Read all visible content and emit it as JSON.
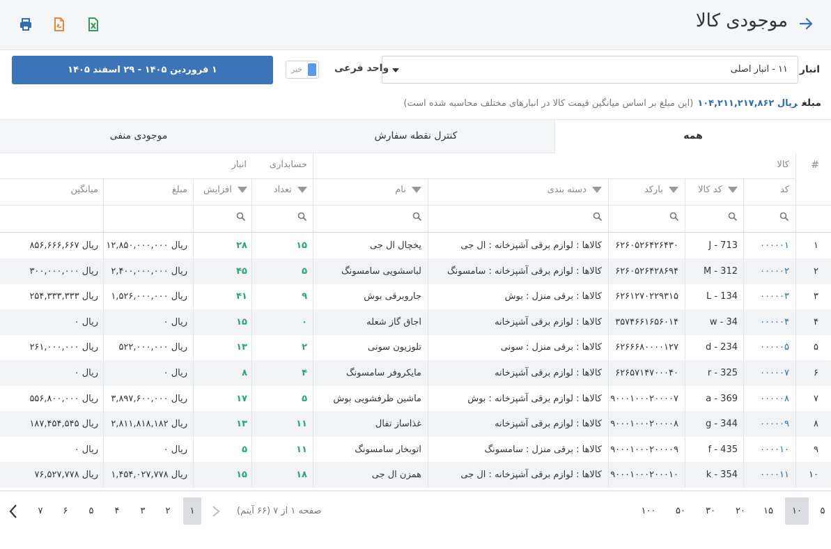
{
  "header": {
    "title": "موجودی کالا",
    "back_icon": "arrow-right-icon",
    "tools": [
      {
        "name": "print-icon",
        "color": "#2f6db3"
      },
      {
        "name": "pdf-export-icon",
        "color": "#e58a2f"
      },
      {
        "name": "excel-export-icon",
        "color": "#2e9c5b"
      }
    ]
  },
  "filters": {
    "warehouse_label": "انبار",
    "warehouse_value": "۱۱ - انبار اصلی",
    "sub_unit_label": "واحد فرعی",
    "sub_unit_toggle": "خیر",
    "date_range": "۱ فروردین ۱۴۰۵ - ۲۹ اسفند ۱۴۰۵"
  },
  "amount": {
    "label": "مبلغ",
    "value": "ریال ۱۰۴,۲۱۱,۲۱۷,۸۶۲",
    "note": "(این مبلغ بر اساس میانگین قیمت کالا در انبارهای مختلف محاسبه شده است)"
  },
  "tabs": [
    {
      "label": "همه",
      "active": true
    },
    {
      "label": "کنترل نقطه سفارش",
      "active": false
    },
    {
      "label": "موجودی منفی",
      "active": false
    }
  ],
  "columns": {
    "row_num": "#",
    "group_goods": "کالا",
    "group_accounting": "حسابداری",
    "group_warehouse": "انبار",
    "code": "کد",
    "goods_code": "کد کالا",
    "barcode": "بارکد",
    "category": "دسته بندی",
    "name": "نام",
    "count": "تعداد",
    "increase": "افزایش",
    "amount": "مبلغ",
    "average": "میانگین"
  },
  "rows": [
    {
      "num": "۱",
      "code": "۰۰۰۰۰۱",
      "goods_code": "J - 713",
      "barcode": "۶۲۶۰۵۲۶۴۲۶۴۳۰",
      "category": "کالاها : لوازم برقی آشپزخانه : ال جی",
      "name": "یخچال ال جی",
      "count": "۱۵",
      "increase": "۲۸",
      "amount": "ریال ۱۲,۸۵۰,۰۰۰,۰۰۰",
      "average": "ریال ۸۵۶,۶۶۶,۶۶۷"
    },
    {
      "num": "۲",
      "code": "۰۰۰۰۰۲",
      "goods_code": "M - 312",
      "barcode": "۶۲۶۰۵۲۶۴۲۸۶۹۴",
      "category": "کالاها : لوازم برقی آشپزخانه : سامسونگ",
      "name": "لباسشویی سامسونگ",
      "count": "۵",
      "increase": "۴۵",
      "amount": "ریال ۲,۴۰۰,۰۰۰,۰۰۰",
      "average": "ریال ۳۰۰,۰۰۰,۰۰۰"
    },
    {
      "num": "۳",
      "code": "۰۰۰۰۰۳",
      "goods_code": "L - 134",
      "barcode": "۶۲۶۱۲۷۰۲۲۹۳۱۵",
      "category": "کالاها : برقی منزل : بوش",
      "name": "جاروبرقی بوش",
      "count": "۹",
      "increase": "۴۱",
      "amount": "ریال ۱,۵۲۶,۰۰۰,۰۰۰",
      "average": "ریال ۲۵۴,۳۳۳,۳۳۳"
    },
    {
      "num": "۴",
      "code": "۰۰۰۰۰۴",
      "goods_code": "w - 34",
      "barcode": "۳۵۷۴۶۶۱۶۵۶۰۱۴",
      "category": "کالاها : لوازم برقی آشپزخانه",
      "name": "اجاق گاز شعله",
      "count": "۰",
      "increase": "۱۵",
      "amount": "ریال ۰",
      "average": "ریال ۰"
    },
    {
      "num": "۵",
      "code": "۰۰۰۰۰۵",
      "goods_code": "d - 234",
      "barcode": "۶۲۶۶۶۸۰۰۰۰۱۲۷",
      "category": "کالاها : برقی منزل : سونی",
      "name": "تلوزیون سونی",
      "count": "۲",
      "increase": "۱۳",
      "amount": "ریال ۵۲۲,۰۰۰,۰۰۰",
      "average": "ریال ۲۶۱,۰۰۰,۰۰۰"
    },
    {
      "num": "۶",
      "code": "۰۰۰۰۰۷",
      "goods_code": "r - 325",
      "barcode": "۶۲۶۵۷۱۴۷۰۰۰۴۰",
      "category": "کالاها : لوازم برقی آشپزخانه",
      "name": "مایکروفر سامسونگ",
      "count": "۴",
      "increase": "۸",
      "amount": "ریال ۰",
      "average": "ریال ۰"
    },
    {
      "num": "۷",
      "code": "۰۰۰۰۰۸",
      "goods_code": "a - 369",
      "barcode": "۹۰۰۰۱۰۰۰۲۰۰۰۰۷",
      "category": "کالاها : لوازم برقی آشپزخانه : بوش",
      "name": "ماشین ظرفشویی بوش",
      "count": "۵",
      "increase": "۱۷",
      "amount": "ریال ۳,۸۹۷,۶۰۰,۰۰۰",
      "average": "ریال ۵۵۶,۸۰۰,۰۰۰"
    },
    {
      "num": "۸",
      "code": "۰۰۰۰۰۹",
      "goods_code": "g - 344",
      "barcode": "۹۰۰۰۱۰۰۰۲۰۰۰۰۸",
      "category": "کالاها : لوازم برقی آشپزخانه",
      "name": "غذاساز تفال",
      "count": "۱۱",
      "increase": "۱۳",
      "amount": "ریال ۲,۸۱۱,۸۱۸,۱۸۲",
      "average": "ریال ۱۸۷,۴۵۴,۵۴۵"
    },
    {
      "num": "۹",
      "code": "۰۰۰۰۱۰",
      "goods_code": "f - 435",
      "barcode": "۹۰۰۰۱۰۰۰۲۰۰۰۰۹",
      "category": "کالاها : برقی منزل : سامسونگ",
      "name": "اتوبخار سامسونگ",
      "count": "۱۱",
      "increase": "۵",
      "amount": "ریال ۰",
      "average": "ریال ۰"
    },
    {
      "num": "۱۰",
      "code": "۰۰۰۰۱۱",
      "goods_code": "k - 354",
      "barcode": "۹۰۰۰۱۰۰۰۲۰۰۰۱۰",
      "category": "کالاها : لوازم برقی آشپزخانه : ال جی",
      "name": "همزن ال جی",
      "count": "۱۸",
      "increase": "۱۵",
      "amount": "ریال ۱,۴۵۴,۰۲۷,۷۷۸",
      "average": "ریال ۷۶,۵۲۷,۷۷۸"
    }
  ],
  "pager": {
    "sizes": [
      "۵",
      "۱۰",
      "۱۵",
      "۲۰",
      "۳۰",
      "۵۰",
      "۱۰۰"
    ],
    "selected_size": "۱۰",
    "info": "صفحه ۱ از ۷ (۶۶ آیتم)",
    "pages": [
      "۱",
      "۲",
      "۳",
      "۴",
      "۵",
      "۶",
      "۷"
    ],
    "current_page": "۱"
  }
}
